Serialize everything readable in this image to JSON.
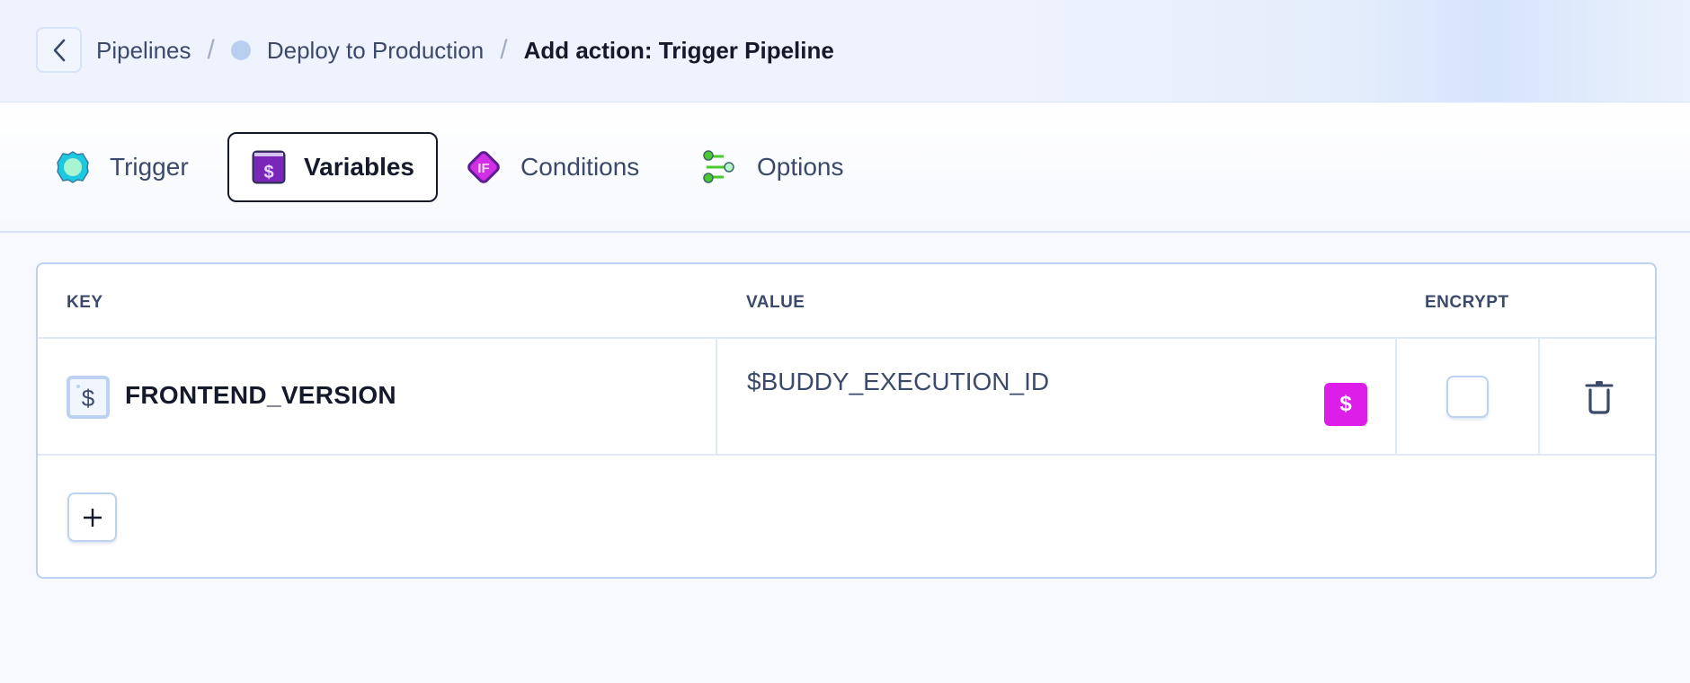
{
  "breadcrumb": {
    "back_icon": "chevron-left-icon",
    "items": [
      {
        "label": "Pipelines"
      },
      {
        "label": "Deploy to Production",
        "status_dot_color": "#b9cff0"
      },
      {
        "label": "Add action: Trigger Pipeline"
      }
    ],
    "separator": "/"
  },
  "tabs": [
    {
      "label": "Trigger",
      "icon": "gear-icon",
      "active": false
    },
    {
      "label": "Variables",
      "icon": "variable-dollar-icon",
      "active": true
    },
    {
      "label": "Conditions",
      "icon": "if-diamond-icon",
      "active": false
    },
    {
      "label": "Options",
      "icon": "sliders-icon",
      "active": false
    }
  ],
  "table": {
    "columns": [
      "KEY",
      "VALUE",
      "ENCRYPT"
    ],
    "rows": [
      {
        "key": "FRONTEND_VERSION",
        "value": "$BUDDY_EXECUTION_ID",
        "variable_button_label": "$",
        "encrypt": false
      }
    ],
    "add_button_label": "+"
  },
  "colors": {
    "accent_magenta": "#dc1ee8",
    "text_dark": "#141a2b",
    "text_muted": "#3b4a6b",
    "border_light": "#bcd2f0"
  }
}
